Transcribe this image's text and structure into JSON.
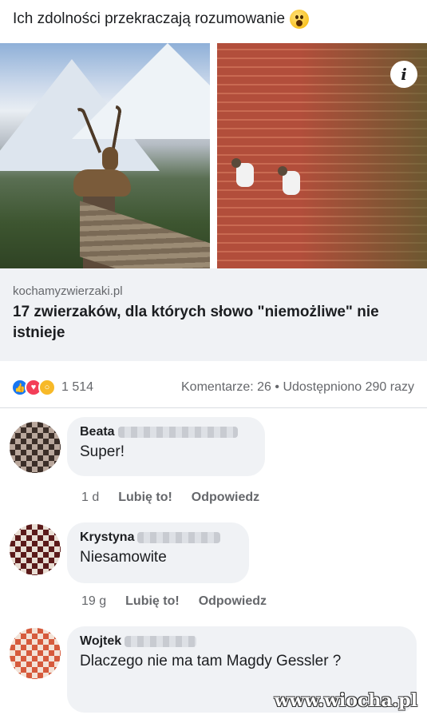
{
  "post": {
    "text": "Ich zdolności przekraczają rozumowanie",
    "emoji_icon": "astonished-face-emoji"
  },
  "link": {
    "domain": "kochamyzwierzaki.pl",
    "title": "17 zwierzaków, dla których słowo \"niemożliwe\" nie istnieje",
    "info_icon_label": "i",
    "images": [
      "ibex-on-chimney-photo",
      "goats-on-brick-wall-photo"
    ]
  },
  "engagement": {
    "reaction_icons": [
      "like-icon",
      "love-icon",
      "wow-icon"
    ],
    "reaction_count": "1 514",
    "stats": "Komentarze: 26 • Udostępniono 290 razy"
  },
  "comments": [
    {
      "name": "Beata",
      "text": "Super!",
      "time": "1 d",
      "like": "Lubię to!",
      "reply": "Odpowiedz"
    },
    {
      "name": "Krystyna",
      "text": "Niesamowite",
      "time": "19 g",
      "like": "Lubię to!",
      "reply": "Odpowiedz"
    },
    {
      "name": "Wojtek",
      "text": "Dlaczego nie ma tam Magdy Gessler ?"
    }
  ],
  "watermark": "www.wiocha.pl",
  "colors": {
    "accent": "#1877f2",
    "bubble": "#f0f2f5",
    "muted": "#65676b"
  }
}
